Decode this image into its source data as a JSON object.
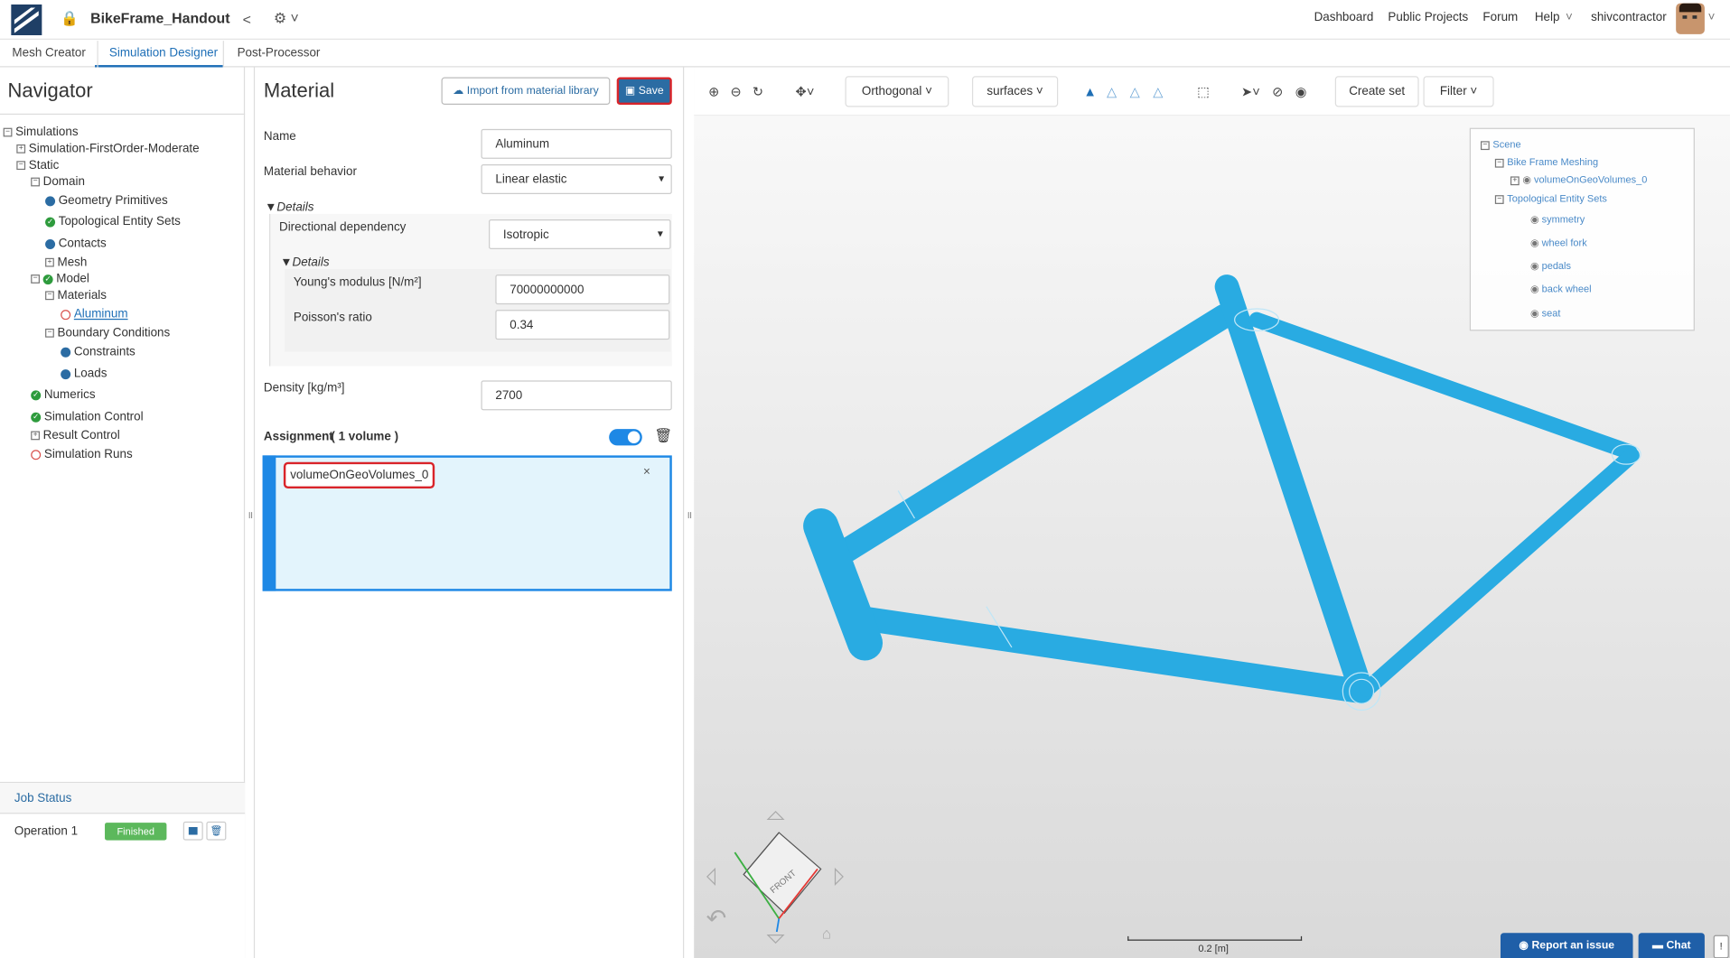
{
  "header": {
    "title": "BikeFrame_Handout",
    "nav": [
      "Dashboard",
      "Public Projects",
      "Forum",
      "Help"
    ],
    "user": "shivcontractor"
  },
  "tabs": [
    "Mesh Creator",
    "Simulation Designer",
    "Post-Processor"
  ],
  "navigator": {
    "title": "Navigator",
    "items": {
      "simulations": "Simulations",
      "sim1": "Simulation-FirstOrder-Moderate",
      "static": "Static",
      "domain": "Domain",
      "geometry": "Geometry Primitives",
      "topo": "Topological Entity Sets",
      "contacts": "Contacts",
      "mesh": "Mesh",
      "model": "Model",
      "materials": "Materials",
      "aluminum": "Aluminum",
      "bc": "Boundary Conditions",
      "constraints": "Constraints",
      "loads": "Loads",
      "numerics": "Numerics",
      "simcontrol": "Simulation Control",
      "result": "Result Control",
      "runs": "Simulation Runs"
    }
  },
  "job": {
    "title": "Job Status",
    "op": "Operation 1",
    "status": "Finished"
  },
  "material": {
    "title": "Material",
    "import_label": "Import from material library",
    "save_label": "Save",
    "name_label": "Name",
    "name_value": "Aluminum",
    "behavior_label": "Material behavior",
    "behavior_value": "Linear elastic",
    "details": "Details",
    "dir_label": "Directional dependency",
    "dir_value": "Isotropic",
    "youngs_label": "Young's modulus [N/m²]",
    "youngs_value": "70000000000",
    "poisson_label": "Poisson's ratio",
    "poisson_value": "0.34",
    "density_label": "Density [kg/m³]",
    "density_value": "2700",
    "assignment_label": "Assignment",
    "assignment_count": "( 1 volume )",
    "assigned": "volumeOnGeoVolumes_0"
  },
  "viewer": {
    "projection": "Orthogonal",
    "render": "surfaces",
    "create_set": "Create set",
    "filter": "Filter",
    "scale": "0.2 [m]",
    "cube_label": "FRONT",
    "scene": {
      "root": "Scene",
      "meshing": "Bike Frame Meshing",
      "volume": "volumeOnGeoVolumes_0",
      "topo": "Topological Entity Sets",
      "sets": [
        "symmetry",
        "wheel fork",
        "pedals",
        "back wheel",
        "seat"
      ]
    }
  },
  "footer": {
    "report": "Report an issue",
    "chat": "Chat"
  },
  "colors": {
    "accent": "#2b6ca3",
    "frame": "#29abe2",
    "status_ok": "#5cb85c"
  }
}
